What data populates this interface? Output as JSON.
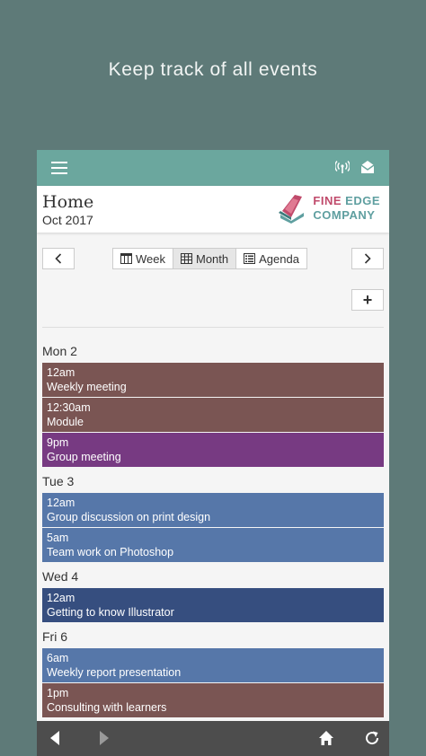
{
  "promo": {
    "text": "Keep track of all events"
  },
  "header": {
    "title": "Home",
    "subtitle": "Oct 2017",
    "logo": {
      "line1a": "FINE",
      "line1b": "EDGE",
      "line2": "COMPANY"
    }
  },
  "toolbar": {
    "prev_label": "‹",
    "next_label": "›",
    "views": [
      "Week",
      "Month",
      "Agenda"
    ],
    "active_view": "Month",
    "add_label": "+"
  },
  "icons": {
    "menu": "hamburger-icon",
    "broadcast": "broadcast-icon",
    "mail": "mail-open-icon",
    "back": "back-arrow-icon",
    "forward": "forward-arrow-icon",
    "home": "home-icon",
    "refresh": "refresh-icon"
  },
  "colors": {
    "background": "#5e7a78",
    "appbar": "#6ba79e",
    "event_brown": "#7a5553",
    "event_purple": "#773a82",
    "event_blue": "#5677a9",
    "event_navy": "#364e7f"
  },
  "agenda": [
    {
      "day": "Mon 2",
      "events": [
        {
          "time": "12am",
          "title": "Weekly meeting",
          "color": "#7a5553"
        },
        {
          "time": "12:30am",
          "title": "Module",
          "color": "#7a5553"
        },
        {
          "time": "9pm",
          "title": "Group meeting",
          "color": "#773a82"
        }
      ]
    },
    {
      "day": "Tue 3",
      "events": [
        {
          "time": "12am",
          "title": "Group discussion on print design",
          "color": "#5677a9"
        },
        {
          "time": "5am",
          "title": "Team work on Photoshop",
          "color": "#5677a9"
        }
      ]
    },
    {
      "day": "Wed 4",
      "events": [
        {
          "time": "12am",
          "title": "Getting to know Illustrator",
          "color": "#364e7f"
        }
      ]
    },
    {
      "day": "Fri 6",
      "events": [
        {
          "time": "6am",
          "title": "Weekly report presentation",
          "color": "#5677a9"
        },
        {
          "time": "1pm",
          "title": "Consulting with learners",
          "color": "#7a5553"
        }
      ]
    }
  ]
}
